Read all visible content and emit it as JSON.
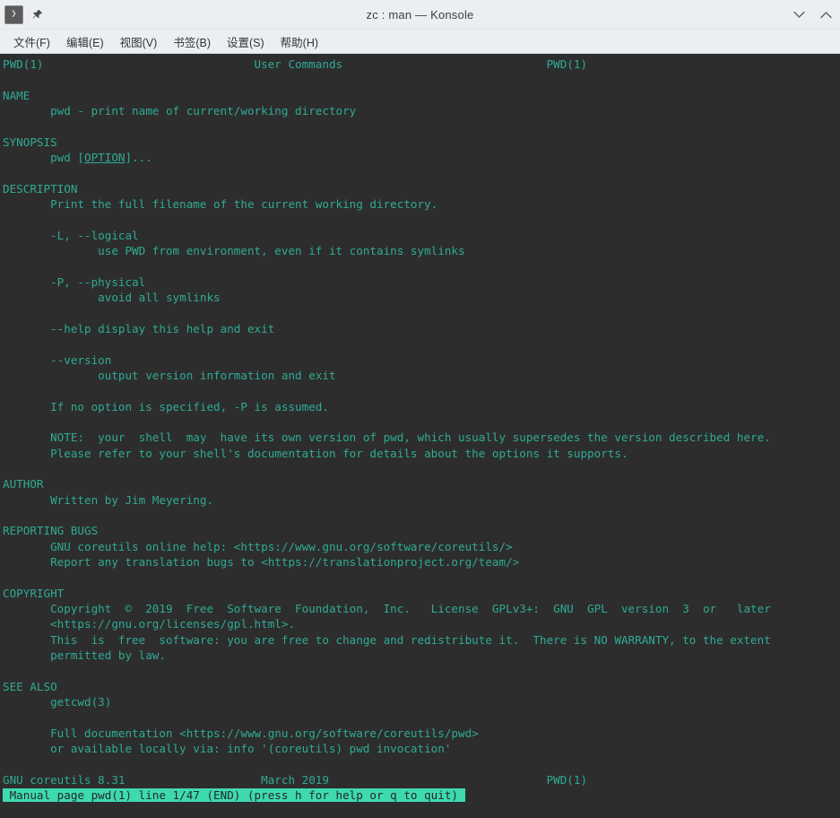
{
  "window": {
    "title": "zc : man — Konsole",
    "app_icon": "konsole-terminal-icon",
    "pin_icon": "pin-icon",
    "minimize_icon": "chevron-down-icon",
    "maximize_icon": "chevron-up-icon"
  },
  "menubar": {
    "items": [
      {
        "label": "文件(F)",
        "name": "menu-file"
      },
      {
        "label": "编辑(E)",
        "name": "menu-edit"
      },
      {
        "label": "视图(V)",
        "name": "menu-view"
      },
      {
        "label": "书签(B)",
        "name": "menu-bookmarks"
      },
      {
        "label": "设置(S)",
        "name": "menu-settings"
      },
      {
        "label": "帮助(H)",
        "name": "menu-help"
      }
    ]
  },
  "colors": {
    "titlebar_bg": "#eceff1",
    "terminal_bg": "#2d2d2d",
    "terminal_fg": "#2fab93",
    "status_bg": "#3fd9b0",
    "status_fg": "#23282a"
  },
  "terminal": {
    "header": {
      "left": "PWD(1)",
      "center": "User Commands",
      "right": "PWD(1)"
    },
    "footer": {
      "left": "GNU coreutils 8.31",
      "center": "March 2019",
      "right": "PWD(1)"
    },
    "status_text": " Manual page pwd(1) line 1/47 (END) (press h for help or q to quit) ",
    "lines": [
      "PWD(1)                               User Commands                              PWD(1)",
      "",
      "NAME",
      "       pwd - print name of current/working directory",
      "",
      "SYNOPSIS",
      "       pwd [OPTION]...",
      "",
      "DESCRIPTION",
      "       Print the full filename of the current working directory.",
      "",
      "       -L, --logical",
      "              use PWD from environment, even if it contains symlinks",
      "",
      "       -P, --physical",
      "              avoid all symlinks",
      "",
      "       --help display this help and exit",
      "",
      "       --version",
      "              output version information and exit",
      "",
      "       If no option is specified, -P is assumed.",
      "",
      "       NOTE:  your  shell  may  have its own version of pwd, which usually supersedes the version described here.",
      "       Please refer to your shell's documentation for details about the options it supports.",
      "",
      "AUTHOR",
      "       Written by Jim Meyering.",
      "",
      "REPORTING BUGS",
      "       GNU coreutils online help: <https://www.gnu.org/software/coreutils/>",
      "       Report any translation bugs to <https://translationproject.org/team/>",
      "",
      "COPYRIGHT",
      "       Copyright  ©  2019  Free  Software  Foundation,  Inc.   License  GPLv3+:  GNU  GPL  version  3  or   later",
      "       <https://gnu.org/licenses/gpl.html>.",
      "       This  is  free  software: you are free to change and redistribute it.  There is NO WARRANTY, to the extent",
      "       permitted by law.",
      "",
      "SEE ALSO",
      "       getcwd(3)",
      "",
      "       Full documentation <https://www.gnu.org/software/coreutils/pwd>",
      "       or available locally via: info '(coreutils) pwd invocation'",
      "",
      "GNU coreutils 8.31                    March 2019                                PWD(1)"
    ],
    "synopsis": {
      "prefix": "       pwd [",
      "option": "OPTION",
      "suffix": "]..."
    }
  }
}
